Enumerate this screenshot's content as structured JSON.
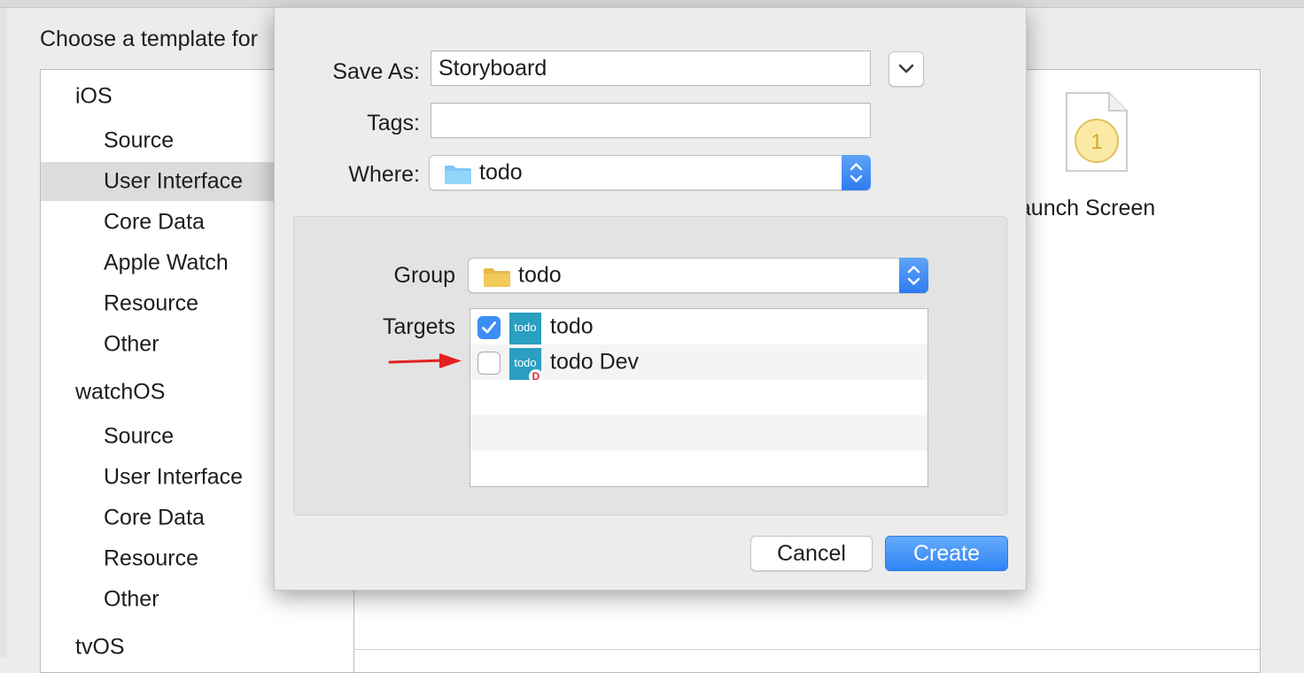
{
  "background_window": {
    "title": "Choose a template for",
    "sidebar": [
      {
        "label": "iOS",
        "kind": "header"
      },
      {
        "label": "Source",
        "kind": "sub"
      },
      {
        "label": "User Interface",
        "kind": "sub",
        "selected": true
      },
      {
        "label": "Core Data",
        "kind": "sub"
      },
      {
        "label": "Apple Watch",
        "kind": "sub"
      },
      {
        "label": "Resource",
        "kind": "sub"
      },
      {
        "label": "Other",
        "kind": "sub"
      },
      {
        "label": "watchOS",
        "kind": "header"
      },
      {
        "label": "Source",
        "kind": "sub"
      },
      {
        "label": "User Interface",
        "kind": "sub"
      },
      {
        "label": "Core Data",
        "kind": "sub"
      },
      {
        "label": "Resource",
        "kind": "sub"
      },
      {
        "label": "Other",
        "kind": "sub"
      },
      {
        "label": "tvOS",
        "kind": "header"
      }
    ],
    "template": {
      "label": "Launch Screen",
      "icon_badge": "1",
      "icon": "launch-screen-file-icon"
    }
  },
  "save_sheet": {
    "save_as": {
      "label": "Save As:",
      "value": "Storyboard"
    },
    "tags": {
      "label": "Tags:",
      "value": ""
    },
    "where": {
      "label": "Where:",
      "value": "todo"
    },
    "group": {
      "label": "Group",
      "value": "todo"
    },
    "targets": {
      "label": "Targets",
      "items": [
        {
          "name": "todo",
          "checked": true,
          "icon_text": "todo",
          "badge": ""
        },
        {
          "name": "todo Dev",
          "checked": false,
          "icon_text": "todo",
          "badge": "D"
        }
      ]
    },
    "buttons": {
      "cancel": "Cancel",
      "create": "Create"
    }
  },
  "colors": {
    "accent": "#2f84f5",
    "app_icon": "#2a9fc0",
    "folder_blue": "#7ec8f5",
    "folder_yellow": "#f1c95a",
    "annotation_arrow": "#e32020"
  }
}
